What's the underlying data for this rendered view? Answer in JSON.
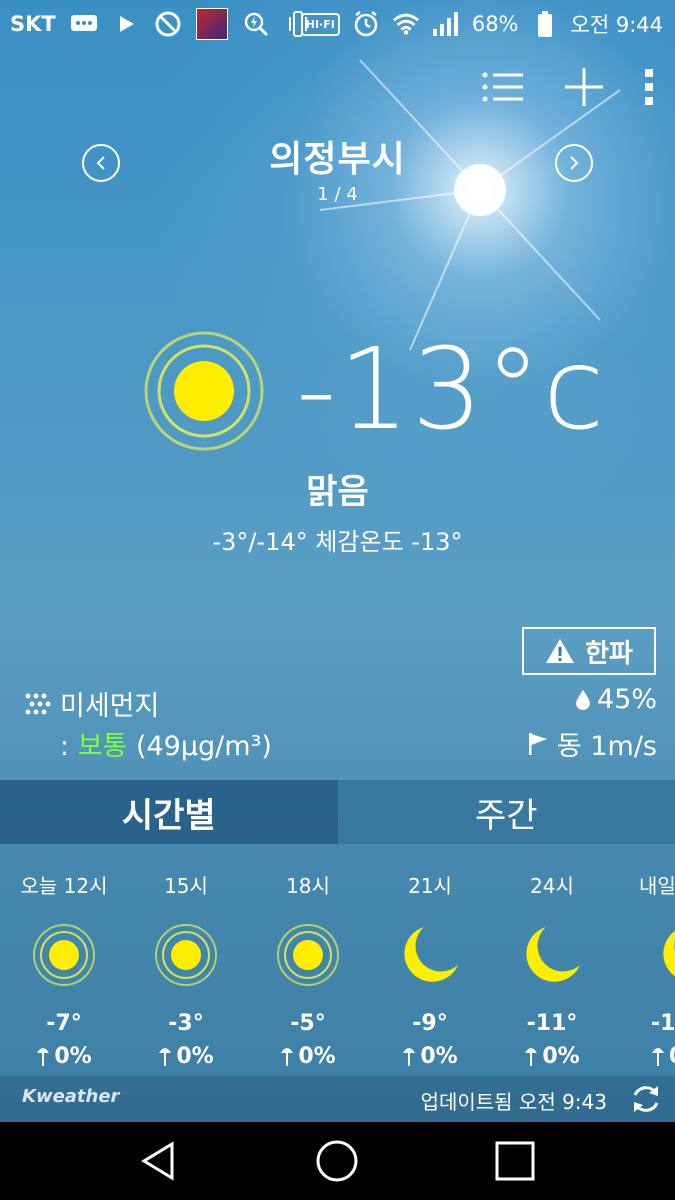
{
  "status_bar": {
    "carrier": "SKT",
    "battery": "68%",
    "time": "오전 9:44",
    "hifi_label": "HI·FI"
  },
  "location": {
    "city": "의정부시",
    "page": "1 / 4"
  },
  "current": {
    "temperature": "-13°c",
    "condition": "맑음",
    "range_feels": "-3°/-14° 체감온도 -13°",
    "alert": "한파",
    "dust_label": "미세먼지",
    "dust_prefix": ": ",
    "dust_level": "보통",
    "dust_value": "(49µg/m³)",
    "humidity": "45%",
    "wind": "동 1m/s"
  },
  "tabs": [
    {
      "label": "시간별",
      "active": true
    },
    {
      "label": "주간",
      "active": false
    }
  ],
  "hourly": [
    {
      "label": "오늘 12시",
      "icon": "sun-icon",
      "temp": "-7°",
      "rain": "0%"
    },
    {
      "label": "15시",
      "icon": "sun-icon",
      "temp": "-3°",
      "rain": "0%"
    },
    {
      "label": "18시",
      "icon": "sun-icon",
      "temp": "-5°",
      "rain": "0%"
    },
    {
      "label": "21시",
      "icon": "moon-icon",
      "temp": "-9°",
      "rain": "0%"
    },
    {
      "label": "24시",
      "icon": "moon-icon",
      "temp": "-11°",
      "rain": "0%"
    },
    {
      "label": "내일",
      "icon": "moon-icon",
      "temp": "-1",
      "rain": "0"
    }
  ],
  "footer": {
    "brand": "Kweather",
    "updated": "업데이트됨 오전 9:43"
  },
  "colors": {
    "sun": "#ffee00",
    "dust_good": "#7dff3a"
  }
}
